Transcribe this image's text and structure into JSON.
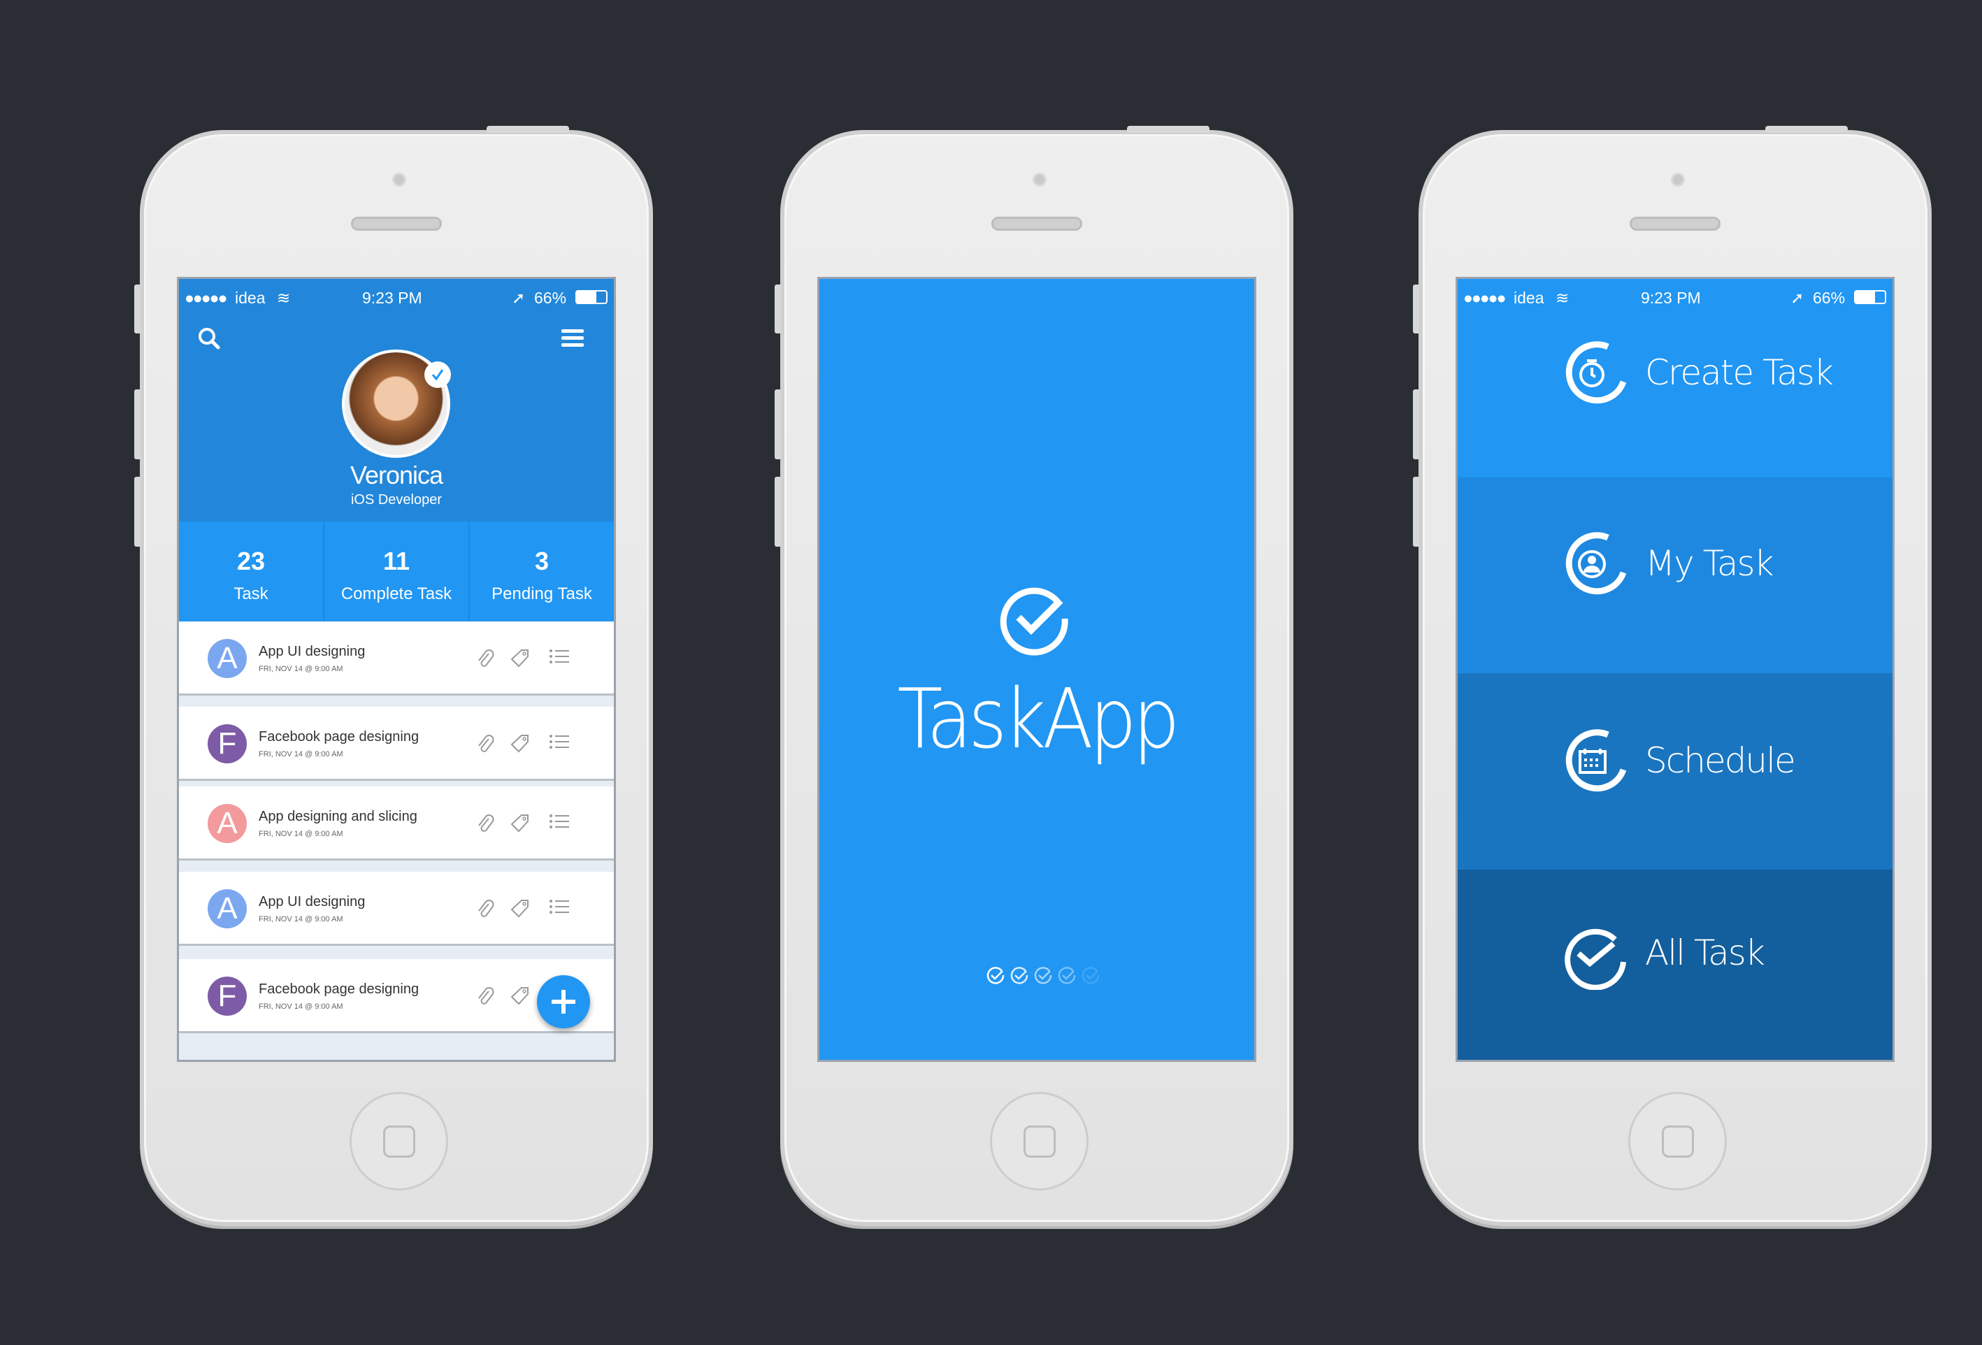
{
  "status_bar": {
    "carrier": "idea",
    "time": "9:23 PM",
    "battery": "66%",
    "battery_level": 0.66,
    "signal_dots": 5
  },
  "profile": {
    "name": "Veronica",
    "role": "iOS Developer",
    "verified": true
  },
  "stats": [
    {
      "value": "23",
      "label": "Task"
    },
    {
      "value": "11",
      "label": "Complete Task"
    },
    {
      "value": "3",
      "label": "Pending Task"
    }
  ],
  "tasks": [
    {
      "initial": "A",
      "title": "App UI designing",
      "date": "FRI, NOV 14 @ 9:00 AM",
      "color": "#7aa7f0"
    },
    {
      "initial": "F",
      "title": "Facebook page designing",
      "date": "FRI, NOV 14 @ 9:00 AM",
      "color": "#7e5ba6"
    },
    {
      "initial": "A",
      "title": "App designing and slicing",
      "date": "FRI, NOV 14 @ 9:00 AM",
      "color": "#f39a9c"
    },
    {
      "initial": "A",
      "title": "App UI designing",
      "date": "FRI, NOV 14 @ 9:00 AM",
      "color": "#7aa7f0"
    },
    {
      "initial": "F",
      "title": "Facebook page designing",
      "date": "FRI, NOV 14 @ 9:00 AM",
      "color": "#7e5ba6"
    }
  ],
  "splash": {
    "app_name": "TaskApp",
    "loading_steps": 5,
    "loading_active": 4
  },
  "menu": [
    {
      "label": "Create Task",
      "icon": "stopwatch-icon",
      "color": "#2196f3"
    },
    {
      "label": "My Task",
      "icon": "user-icon",
      "color": "#1e88e0"
    },
    {
      "label": "Schedule",
      "icon": "calendar-icon",
      "color": "#1a75c0"
    },
    {
      "label": "All Task",
      "icon": "check-icon",
      "color": "#135e9c"
    }
  ],
  "colors": {
    "background": "#2a2d33",
    "primary": "#2196f3",
    "header": "#2287da"
  }
}
